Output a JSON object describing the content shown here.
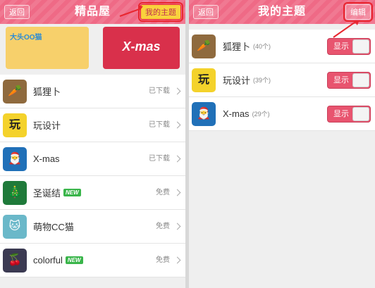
{
  "left_panel": {
    "back_label": "返回",
    "title": "精品屋",
    "my_theme_label": "我的主题",
    "banners": [
      {
        "text": "大头OO猫",
        "icon": "fox-cat-banner"
      },
      {
        "text": "X-mas",
        "icon": "christmas-banner"
      }
    ],
    "items": [
      {
        "name": "狐狸卜",
        "status": "已下载",
        "new": "",
        "icon": "fox-icon",
        "thumb": "🥕"
      },
      {
        "name": "玩设计",
        "status": "已下载",
        "new": "",
        "icon": "design-icon",
        "thumb": "玩"
      },
      {
        "name": "X-mas",
        "status": "已下载",
        "new": "",
        "icon": "santa-icon",
        "thumb": "🎅"
      },
      {
        "name": "圣诞结",
        "status": "免费",
        "new": "NEW",
        "icon": "wreath-icon",
        "thumb": "🎄"
      },
      {
        "name": "萌物CC猫",
        "status": "免费",
        "new": "",
        "icon": "cat-icon",
        "thumb": "🐱"
      },
      {
        "name": "colorful",
        "status": "免费",
        "new": "NEW",
        "icon": "cherry-icon",
        "thumb": "🍒"
      }
    ]
  },
  "right_panel": {
    "back_label": "返回",
    "title": "我的主题",
    "edit_label": "编辑",
    "items": [
      {
        "name": "狐狸卜",
        "count": "(40个)",
        "toggle_label": "显示",
        "icon": "fox-icon",
        "thumb": "🥕"
      },
      {
        "name": "玩设计",
        "count": "(39个)",
        "toggle_label": "显示",
        "icon": "design-icon",
        "thumb": "玩"
      },
      {
        "name": "X-mas",
        "count": "(29个)",
        "toggle_label": "显示",
        "icon": "santa-icon",
        "thumb": "🎅"
      }
    ]
  },
  "colors": {
    "accent": "#ef6a86",
    "toggle_on": "#e8546f",
    "highlight": "#e8262f",
    "new_badge": "#39b54a"
  }
}
